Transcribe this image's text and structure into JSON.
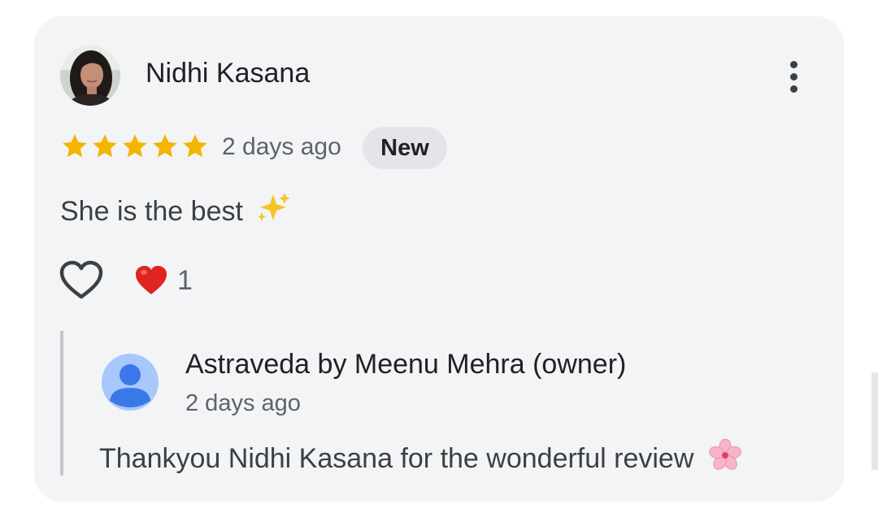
{
  "review": {
    "reviewer_name": "Nidhi Kasana",
    "rating": 5,
    "max_rating": 5,
    "date": "2 days ago",
    "badge": "New",
    "text": "She is the best",
    "reaction_count": "1",
    "icons": {
      "avatar": "reviewer-photo",
      "star": "star-icon",
      "menu": "more-vert-icon",
      "sparkle": "sparkles-emoji",
      "like": "heart-outline-icon",
      "reaction": "red-heart-emoji"
    }
  },
  "reply": {
    "owner_name": "Astraveda by Meenu Mehra (owner)",
    "date": "2 days ago",
    "text": "Thankyou Nidhi Kasana for the wonderful review",
    "icons": {
      "avatar": "default-person-avatar",
      "emoji": "cherry-blossom-emoji"
    }
  },
  "colors": {
    "star": "#f5b400",
    "card_bg": "#f3f4f6",
    "badge_bg": "#e3e5e8",
    "reply_border": "#c6c8cb",
    "heart": "#e0241f",
    "owner_avatar_bg": "#a8c7fa",
    "owner_avatar_fg": "#3b78e7"
  }
}
